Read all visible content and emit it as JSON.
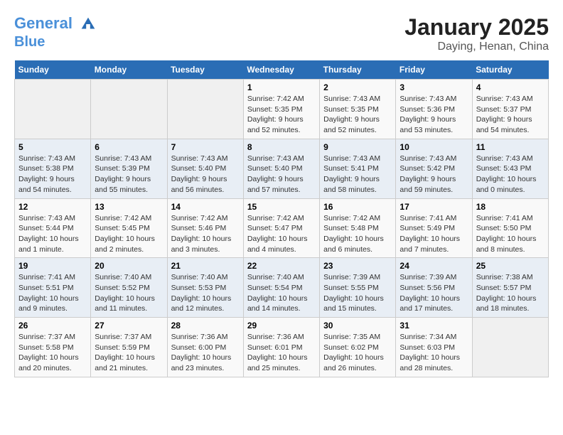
{
  "header": {
    "logo_line1": "General",
    "logo_line2": "Blue",
    "title": "January 2025",
    "subtitle": "Daying, Henan, China"
  },
  "weekdays": [
    "Sunday",
    "Monday",
    "Tuesday",
    "Wednesday",
    "Thursday",
    "Friday",
    "Saturday"
  ],
  "weeks": [
    [
      {
        "day": "",
        "info": ""
      },
      {
        "day": "",
        "info": ""
      },
      {
        "day": "",
        "info": ""
      },
      {
        "day": "1",
        "info": "Sunrise: 7:42 AM\nSunset: 5:35 PM\nDaylight: 9 hours and 52 minutes."
      },
      {
        "day": "2",
        "info": "Sunrise: 7:43 AM\nSunset: 5:35 PM\nDaylight: 9 hours and 52 minutes."
      },
      {
        "day": "3",
        "info": "Sunrise: 7:43 AM\nSunset: 5:36 PM\nDaylight: 9 hours and 53 minutes."
      },
      {
        "day": "4",
        "info": "Sunrise: 7:43 AM\nSunset: 5:37 PM\nDaylight: 9 hours and 54 minutes."
      }
    ],
    [
      {
        "day": "5",
        "info": "Sunrise: 7:43 AM\nSunset: 5:38 PM\nDaylight: 9 hours and 54 minutes."
      },
      {
        "day": "6",
        "info": "Sunrise: 7:43 AM\nSunset: 5:39 PM\nDaylight: 9 hours and 55 minutes."
      },
      {
        "day": "7",
        "info": "Sunrise: 7:43 AM\nSunset: 5:40 PM\nDaylight: 9 hours and 56 minutes."
      },
      {
        "day": "8",
        "info": "Sunrise: 7:43 AM\nSunset: 5:40 PM\nDaylight: 9 hours and 57 minutes."
      },
      {
        "day": "9",
        "info": "Sunrise: 7:43 AM\nSunset: 5:41 PM\nDaylight: 9 hours and 58 minutes."
      },
      {
        "day": "10",
        "info": "Sunrise: 7:43 AM\nSunset: 5:42 PM\nDaylight: 9 hours and 59 minutes."
      },
      {
        "day": "11",
        "info": "Sunrise: 7:43 AM\nSunset: 5:43 PM\nDaylight: 10 hours and 0 minutes."
      }
    ],
    [
      {
        "day": "12",
        "info": "Sunrise: 7:43 AM\nSunset: 5:44 PM\nDaylight: 10 hours and 1 minute."
      },
      {
        "day": "13",
        "info": "Sunrise: 7:42 AM\nSunset: 5:45 PM\nDaylight: 10 hours and 2 minutes."
      },
      {
        "day": "14",
        "info": "Sunrise: 7:42 AM\nSunset: 5:46 PM\nDaylight: 10 hours and 3 minutes."
      },
      {
        "day": "15",
        "info": "Sunrise: 7:42 AM\nSunset: 5:47 PM\nDaylight: 10 hours and 4 minutes."
      },
      {
        "day": "16",
        "info": "Sunrise: 7:42 AM\nSunset: 5:48 PM\nDaylight: 10 hours and 6 minutes."
      },
      {
        "day": "17",
        "info": "Sunrise: 7:41 AM\nSunset: 5:49 PM\nDaylight: 10 hours and 7 minutes."
      },
      {
        "day": "18",
        "info": "Sunrise: 7:41 AM\nSunset: 5:50 PM\nDaylight: 10 hours and 8 minutes."
      }
    ],
    [
      {
        "day": "19",
        "info": "Sunrise: 7:41 AM\nSunset: 5:51 PM\nDaylight: 10 hours and 9 minutes."
      },
      {
        "day": "20",
        "info": "Sunrise: 7:40 AM\nSunset: 5:52 PM\nDaylight: 10 hours and 11 minutes."
      },
      {
        "day": "21",
        "info": "Sunrise: 7:40 AM\nSunset: 5:53 PM\nDaylight: 10 hours and 12 minutes."
      },
      {
        "day": "22",
        "info": "Sunrise: 7:40 AM\nSunset: 5:54 PM\nDaylight: 10 hours and 14 minutes."
      },
      {
        "day": "23",
        "info": "Sunrise: 7:39 AM\nSunset: 5:55 PM\nDaylight: 10 hours and 15 minutes."
      },
      {
        "day": "24",
        "info": "Sunrise: 7:39 AM\nSunset: 5:56 PM\nDaylight: 10 hours and 17 minutes."
      },
      {
        "day": "25",
        "info": "Sunrise: 7:38 AM\nSunset: 5:57 PM\nDaylight: 10 hours and 18 minutes."
      }
    ],
    [
      {
        "day": "26",
        "info": "Sunrise: 7:37 AM\nSunset: 5:58 PM\nDaylight: 10 hours and 20 minutes."
      },
      {
        "day": "27",
        "info": "Sunrise: 7:37 AM\nSunset: 5:59 PM\nDaylight: 10 hours and 21 minutes."
      },
      {
        "day": "28",
        "info": "Sunrise: 7:36 AM\nSunset: 6:00 PM\nDaylight: 10 hours and 23 minutes."
      },
      {
        "day": "29",
        "info": "Sunrise: 7:36 AM\nSunset: 6:01 PM\nDaylight: 10 hours and 25 minutes."
      },
      {
        "day": "30",
        "info": "Sunrise: 7:35 AM\nSunset: 6:02 PM\nDaylight: 10 hours and 26 minutes."
      },
      {
        "day": "31",
        "info": "Sunrise: 7:34 AM\nSunset: 6:03 PM\nDaylight: 10 hours and 28 minutes."
      },
      {
        "day": "",
        "info": ""
      }
    ]
  ]
}
